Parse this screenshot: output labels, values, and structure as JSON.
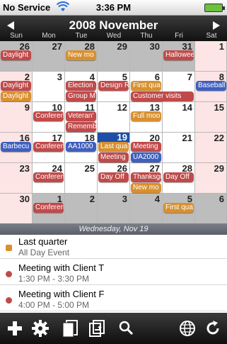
{
  "status": {
    "carrier": "No Service",
    "time": "3:36 PM",
    "battery_color": "#6ec13b"
  },
  "header": {
    "title": "2008 November",
    "prev_icon": "left-triangle-icon",
    "next_icon": "right-triangle-icon",
    "weekdays": [
      "Sun",
      "Mon",
      "Tue",
      "Wed",
      "Thu",
      "Fri",
      "Sat"
    ]
  },
  "calendar": {
    "weeks": [
      {
        "days": [
          {
            "num": "26",
            "kind": "other",
            "events": [
              {
                "label": "Daylight",
                "color": "red"
              }
            ]
          },
          {
            "num": "27",
            "kind": "other",
            "events": []
          },
          {
            "num": "28",
            "kind": "other",
            "events": [
              {
                "label": "New mo",
                "color": "orange"
              }
            ]
          },
          {
            "num": "29",
            "kind": "other",
            "events": []
          },
          {
            "num": "30",
            "kind": "other",
            "events": []
          },
          {
            "num": "31",
            "kind": "other",
            "events": [
              {
                "label": "Hallowee",
                "color": "red"
              }
            ]
          },
          {
            "num": "1",
            "kind": "weekend",
            "events": []
          }
        ]
      },
      {
        "days": [
          {
            "num": "2",
            "kind": "weekend",
            "events": [
              {
                "label": "Daylight",
                "color": "red"
              },
              {
                "label": "Daylight",
                "color": "orange"
              }
            ]
          },
          {
            "num": "3",
            "kind": "normal",
            "events": []
          },
          {
            "num": "4",
            "kind": "normal",
            "events": [
              {
                "label": "Election",
                "color": "red"
              },
              {
                "label": "Group M",
                "color": "red"
              }
            ]
          },
          {
            "num": "5",
            "kind": "normal",
            "events": [
              {
                "label": "Design R",
                "color": "red"
              }
            ]
          },
          {
            "num": "6",
            "kind": "normal",
            "events": [
              {
                "label": "First qua",
                "color": "orange"
              },
              {
                "label": "Customer visits",
                "color": "red",
                "span": 2
              }
            ]
          },
          {
            "num": "7",
            "kind": "normal",
            "events": []
          },
          {
            "num": "8",
            "kind": "weekend",
            "events": [
              {
                "label": "Baseball",
                "color": "blue"
              }
            ]
          }
        ]
      },
      {
        "days": [
          {
            "num": "9",
            "kind": "weekend",
            "events": []
          },
          {
            "num": "10",
            "kind": "normal",
            "events": [
              {
                "label": "Conferen",
                "color": "red"
              }
            ]
          },
          {
            "num": "11",
            "kind": "normal",
            "events": [
              {
                "label": "Veteran'",
                "color": "red"
              },
              {
                "label": "Rememb",
                "color": "red"
              }
            ]
          },
          {
            "num": "12",
            "kind": "normal",
            "events": []
          },
          {
            "num": "13",
            "kind": "normal",
            "events": [
              {
                "label": "Full moo",
                "color": "orange"
              }
            ]
          },
          {
            "num": "14",
            "kind": "normal",
            "events": []
          },
          {
            "num": "15",
            "kind": "weekend",
            "events": []
          }
        ]
      },
      {
        "days": [
          {
            "num": "16",
            "kind": "weekend",
            "events": [
              {
                "label": "Barbecu",
                "color": "blue"
              }
            ]
          },
          {
            "num": "17",
            "kind": "normal",
            "events": [
              {
                "label": "Conferen",
                "color": "red"
              }
            ]
          },
          {
            "num": "18",
            "kind": "normal",
            "events": [
              {
                "label": "AA1000",
                "color": "blue"
              }
            ]
          },
          {
            "num": "19",
            "kind": "today",
            "events": [
              {
                "label": "Last qua",
                "color": "orange"
              },
              {
                "label": "Meeting",
                "color": "red"
              }
            ]
          },
          {
            "num": "20",
            "kind": "normal",
            "events": [
              {
                "label": "Meeting",
                "color": "red"
              },
              {
                "label": "UA2000",
                "color": "blue"
              }
            ]
          },
          {
            "num": "21",
            "kind": "normal",
            "events": []
          },
          {
            "num": "22",
            "kind": "weekend",
            "events": []
          }
        ]
      },
      {
        "days": [
          {
            "num": "23",
            "kind": "weekend",
            "events": []
          },
          {
            "num": "24",
            "kind": "normal",
            "events": [
              {
                "label": "Conferen",
                "color": "red"
              }
            ]
          },
          {
            "num": "25",
            "kind": "normal",
            "events": []
          },
          {
            "num": "26",
            "kind": "normal",
            "events": [
              {
                "label": "Day Off",
                "color": "red"
              }
            ]
          },
          {
            "num": "27",
            "kind": "normal",
            "events": [
              {
                "label": "Thanksgi",
                "color": "red"
              },
              {
                "label": "New mo",
                "color": "orange"
              }
            ]
          },
          {
            "num": "28",
            "kind": "normal",
            "events": [
              {
                "label": "Day Off",
                "color": "red"
              }
            ]
          },
          {
            "num": "29",
            "kind": "weekend",
            "events": []
          }
        ]
      },
      {
        "days": [
          {
            "num": "30",
            "kind": "weekend",
            "events": []
          },
          {
            "num": "1",
            "kind": "other",
            "events": [
              {
                "label": "Conferen",
                "color": "red"
              }
            ]
          },
          {
            "num": "2",
            "kind": "other",
            "events": []
          },
          {
            "num": "3",
            "kind": "other",
            "events": []
          },
          {
            "num": "4",
            "kind": "other",
            "events": []
          },
          {
            "num": "5",
            "kind": "other",
            "events": [
              {
                "label": "First qua",
                "color": "orange"
              }
            ]
          },
          {
            "num": "6",
            "kind": "other",
            "events": []
          }
        ]
      }
    ]
  },
  "selected_day": "Wednesday, Nov 19",
  "agenda": [
    {
      "title": "Last quarter",
      "sub": "All Day Event",
      "marker": "square",
      "color": "#d8902f"
    },
    {
      "title": "Meeting with Client T",
      "sub": "1:30 PM - 3:30 PM",
      "marker": "dot",
      "color": "#c04a4a"
    },
    {
      "title": "Meeting with Client F",
      "sub": "4:00 PM - 5:00 PM",
      "marker": "dot",
      "color": "#c04a4a"
    }
  ],
  "toolbar": {
    "icons": [
      "add-icon",
      "gear-icon",
      "pages-icon",
      "sync-icon",
      "search-icon",
      "globe-icon",
      "refresh-icon"
    ]
  }
}
